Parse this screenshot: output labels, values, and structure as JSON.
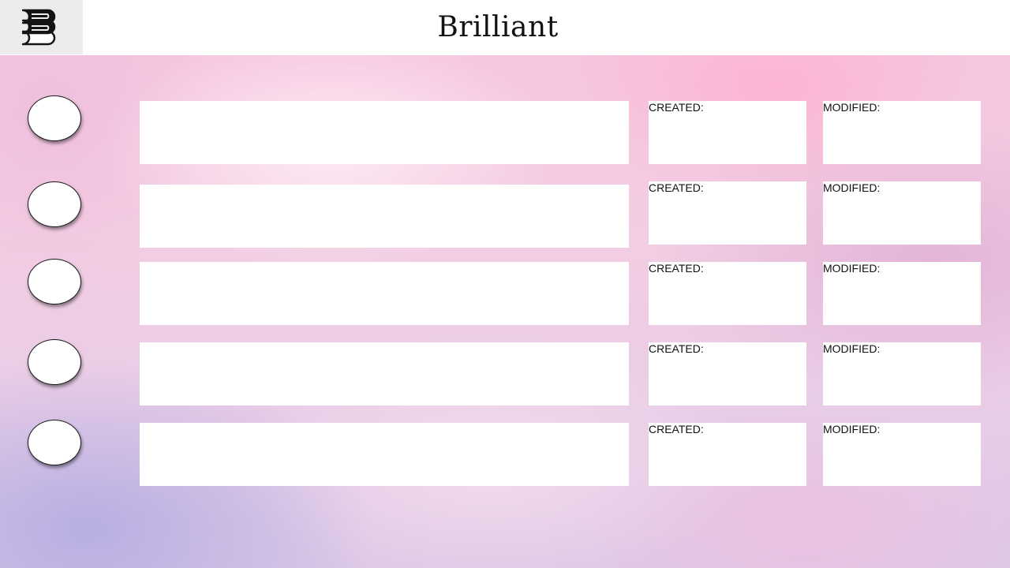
{
  "header": {
    "title": "Brilliant",
    "logo_icon": "books-stack-icon"
  },
  "colors": {
    "header_bg": "#ffffff",
    "logo_bg": "#ececec",
    "card_bg": "#ffffff",
    "bullet_border": "#1a1a1a"
  },
  "rows": [
    {
      "created_label": "CREATED:",
      "modified_label": "MODIFIED:"
    },
    {
      "created_label": "CREATED:",
      "modified_label": "MODIFIED:"
    },
    {
      "created_label": "CREATED:",
      "modified_label": "MODIFIED:"
    },
    {
      "created_label": "CREATED:",
      "modified_label": "MODIFIED:"
    },
    {
      "created_label": "CREATED:",
      "modified_label": "MODIFIED:"
    }
  ]
}
